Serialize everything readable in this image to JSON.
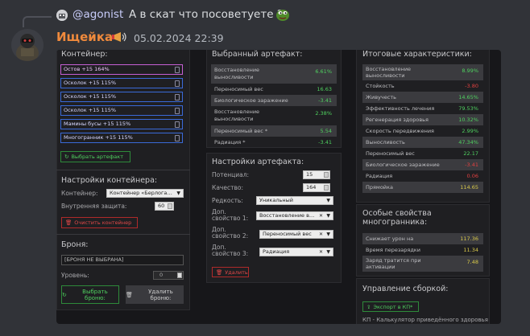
{
  "reply": {
    "username": "@agonist",
    "text": "А в скат что посоветуете ?"
  },
  "message": {
    "username": "Ищейка",
    "timestamp": "05.02.2024 22:39"
  },
  "container_panel": {
    "title": "Контейнер:",
    "slots": [
      "Остов +15 164%",
      "Осколок +15 115%",
      "Осколок +15 115%",
      "Осколок +15 115%",
      "Мамины бусы +15 115%",
      "Многогранник +15 115%"
    ],
    "select_artifact_btn": "Выбрать артефакт"
  },
  "container_settings": {
    "title": "Настройки контейнера:",
    "container_label": "Контейнер:",
    "container_value": "Контейнер «Берлога…",
    "protection_label": "Внутренняя защита:",
    "protection_value": "60",
    "clear_btn": "Очистить контейнер"
  },
  "armor": {
    "title": "Броня:",
    "input_value": "[БРОНЯ НЕ ВЫБРАНА]",
    "level_label": "Уровень:",
    "level_value": "0",
    "select_btn": "Выбрать броню:",
    "delete_btn": "Удалить броню:"
  },
  "selected_artifact": {
    "title": "Выбранный артефакт:",
    "rows": [
      {
        "label": "Восстановление выносливости",
        "value": "6.61%",
        "color": "g"
      },
      {
        "label": "Переносимый вес",
        "value": "16.63",
        "color": "g"
      },
      {
        "label": "Биологическое заражение",
        "value": "-3.41",
        "color": "g"
      },
      {
        "label": "Восстановление выносливости",
        "value": "2.38%",
        "color": "g"
      },
      {
        "label": "Переносимый вес *",
        "value": "5.54",
        "color": "g"
      },
      {
        "label": "Радиация *",
        "value": "-3.41",
        "color": "g"
      }
    ]
  },
  "artifact_settings": {
    "title": "Настройки артефакта:",
    "potential_label": "Потенциал:",
    "potential_value": "15",
    "quality_label": "Качество:",
    "quality_value": "164",
    "rarity_label": "Редкость:",
    "rarity_value": "Уникальный",
    "extra1_label": "Доп. свойство 1:",
    "extra1_value": "Восстановление в…",
    "extra2_label": "Доп. свойство 2:",
    "extra2_value": "Переносимый вес",
    "extra3_label": "Доп. свойство 3:",
    "extra3_value": "Радиация",
    "delete_btn": "Удалить"
  },
  "totals": {
    "title": "Итоговые характеристики:",
    "rows": [
      {
        "label": "Восстановление выносливости",
        "value": "8.99%",
        "color": "g"
      },
      {
        "label": "Стойкость",
        "value": "-3.80",
        "color": "r"
      },
      {
        "label": "Живучесть",
        "value": "14.65%",
        "color": "g"
      },
      {
        "label": "Эффективность лечения",
        "value": "79.53%",
        "color": "g"
      },
      {
        "label": "Регенерация здоровья",
        "value": "10.32%",
        "color": "g"
      },
      {
        "label": "Скорость передвижения",
        "value": "2.99%",
        "color": "g"
      },
      {
        "label": "Выносливость",
        "value": "47.34%",
        "color": "g"
      },
      {
        "label": "Переносимый вес",
        "value": "22.17",
        "color": "g"
      },
      {
        "label": "Биологическое заражение",
        "value": "-3.41",
        "color": "r"
      },
      {
        "label": "Радиация",
        "value": "0.06",
        "color": "r"
      },
      {
        "label": "Прямойка",
        "value": "114.65",
        "color": "y"
      }
    ]
  },
  "special": {
    "title": "Особые свойства многогранника:",
    "rows": [
      {
        "label": "Снижает урон на",
        "value": "117.36",
        "color": "y"
      },
      {
        "label": "Время перезарядки",
        "value": "11.34",
        "color": "y"
      },
      {
        "label": "Заряд тратится при активации",
        "value": "7.48",
        "color": "y"
      }
    ]
  },
  "build": {
    "title": "Управление сборкой:",
    "export_btn": "Экспорт в КП*",
    "footnote": "КП - Калькулятор приведённого здоровья"
  }
}
